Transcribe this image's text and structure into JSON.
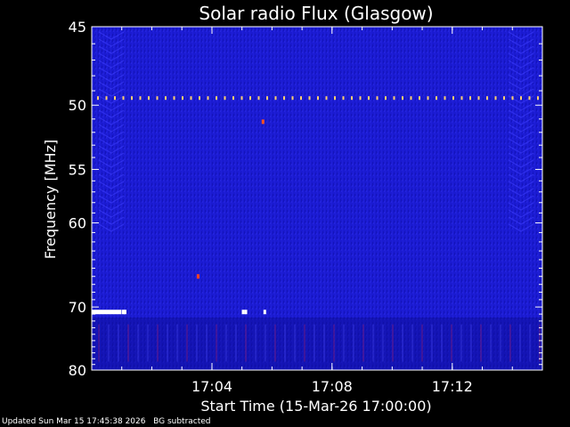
{
  "chart_data": {
    "type": "heatmap",
    "title": "Solar radio Flux (Glasgow)",
    "xlabel": "Start Time (15-Mar-26 17:00:00)",
    "ylabel": "Frequency [MHz]",
    "xlim": [
      17.0,
      17.25
    ],
    "x_ticks": [
      "17:04",
      "17:08",
      "17:12"
    ],
    "x_tick_values": [
      17.0667,
      17.1333,
      17.2
    ],
    "ylim": [
      45,
      80
    ],
    "y_ticks": [
      "45",
      "50",
      "55",
      "60",
      "70",
      "80"
    ],
    "y_tick_values": [
      45,
      50,
      55,
      60,
      70,
      80
    ],
    "y_scale": "reciprocal",
    "background_color": "#1a1ad0",
    "features": [
      {
        "kind": "dashed-line",
        "frequency_mhz": 49.5,
        "color": "#ffd070"
      },
      {
        "kind": "spot",
        "time": 17.095,
        "frequency_mhz": 51.2,
        "color": "#ff5020"
      },
      {
        "kind": "bar",
        "time_start": 17.0,
        "time_end": 17.0165,
        "frequency_mhz": 70.7,
        "color": "#ffffff"
      },
      {
        "kind": "spot",
        "time": 17.0175,
        "frequency_mhz": 70.7,
        "color": "#ffffff"
      },
      {
        "kind": "spot",
        "time": 17.0185,
        "frequency_mhz": 70.7,
        "color": "#ffffff"
      },
      {
        "kind": "spot",
        "time": 17.084,
        "frequency_mhz": 70.7,
        "color": "#ffffff"
      },
      {
        "kind": "spot",
        "time": 17.0855,
        "frequency_mhz": 70.7,
        "color": "#ffffff"
      },
      {
        "kind": "spot",
        "time": 17.096,
        "frequency_mhz": 70.7,
        "color": "#ffffff"
      },
      {
        "kind": "spot",
        "time": 17.059,
        "frequency_mhz": 66.0,
        "color": "#ff4020"
      }
    ]
  },
  "footer": {
    "updated": "Updated Sun Mar 15 17:45:38 2026",
    "note": "BG subtracted"
  },
  "colors": {
    "axis": "#ffffff",
    "text": "#ffffff",
    "page_background": "#000000"
  }
}
